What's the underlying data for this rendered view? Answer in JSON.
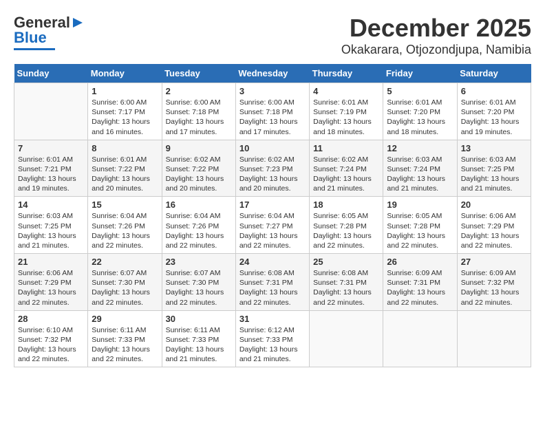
{
  "header": {
    "logo_line1": "General",
    "logo_line2": "Blue",
    "month": "December 2025",
    "location": "Okakarara, Otjozondjupa, Namibia"
  },
  "weekdays": [
    "Sunday",
    "Monday",
    "Tuesday",
    "Wednesday",
    "Thursday",
    "Friday",
    "Saturday"
  ],
  "weeks": [
    [
      {
        "day": "",
        "info": ""
      },
      {
        "day": "1",
        "info": "Sunrise: 6:00 AM\nSunset: 7:17 PM\nDaylight: 13 hours\nand 16 minutes."
      },
      {
        "day": "2",
        "info": "Sunrise: 6:00 AM\nSunset: 7:18 PM\nDaylight: 13 hours\nand 17 minutes."
      },
      {
        "day": "3",
        "info": "Sunrise: 6:00 AM\nSunset: 7:18 PM\nDaylight: 13 hours\nand 17 minutes."
      },
      {
        "day": "4",
        "info": "Sunrise: 6:01 AM\nSunset: 7:19 PM\nDaylight: 13 hours\nand 18 minutes."
      },
      {
        "day": "5",
        "info": "Sunrise: 6:01 AM\nSunset: 7:20 PM\nDaylight: 13 hours\nand 18 minutes."
      },
      {
        "day": "6",
        "info": "Sunrise: 6:01 AM\nSunset: 7:20 PM\nDaylight: 13 hours\nand 19 minutes."
      }
    ],
    [
      {
        "day": "7",
        "info": "Sunrise: 6:01 AM\nSunset: 7:21 PM\nDaylight: 13 hours\nand 19 minutes."
      },
      {
        "day": "8",
        "info": "Sunrise: 6:01 AM\nSunset: 7:22 PM\nDaylight: 13 hours\nand 20 minutes."
      },
      {
        "day": "9",
        "info": "Sunrise: 6:02 AM\nSunset: 7:22 PM\nDaylight: 13 hours\nand 20 minutes."
      },
      {
        "day": "10",
        "info": "Sunrise: 6:02 AM\nSunset: 7:23 PM\nDaylight: 13 hours\nand 20 minutes."
      },
      {
        "day": "11",
        "info": "Sunrise: 6:02 AM\nSunset: 7:24 PM\nDaylight: 13 hours\nand 21 minutes."
      },
      {
        "day": "12",
        "info": "Sunrise: 6:03 AM\nSunset: 7:24 PM\nDaylight: 13 hours\nand 21 minutes."
      },
      {
        "day": "13",
        "info": "Sunrise: 6:03 AM\nSunset: 7:25 PM\nDaylight: 13 hours\nand 21 minutes."
      }
    ],
    [
      {
        "day": "14",
        "info": "Sunrise: 6:03 AM\nSunset: 7:25 PM\nDaylight: 13 hours\nand 21 minutes."
      },
      {
        "day": "15",
        "info": "Sunrise: 6:04 AM\nSunset: 7:26 PM\nDaylight: 13 hours\nand 22 minutes."
      },
      {
        "day": "16",
        "info": "Sunrise: 6:04 AM\nSunset: 7:26 PM\nDaylight: 13 hours\nand 22 minutes."
      },
      {
        "day": "17",
        "info": "Sunrise: 6:04 AM\nSunset: 7:27 PM\nDaylight: 13 hours\nand 22 minutes."
      },
      {
        "day": "18",
        "info": "Sunrise: 6:05 AM\nSunset: 7:28 PM\nDaylight: 13 hours\nand 22 minutes."
      },
      {
        "day": "19",
        "info": "Sunrise: 6:05 AM\nSunset: 7:28 PM\nDaylight: 13 hours\nand 22 minutes."
      },
      {
        "day": "20",
        "info": "Sunrise: 6:06 AM\nSunset: 7:29 PM\nDaylight: 13 hours\nand 22 minutes."
      }
    ],
    [
      {
        "day": "21",
        "info": "Sunrise: 6:06 AM\nSunset: 7:29 PM\nDaylight: 13 hours\nand 22 minutes."
      },
      {
        "day": "22",
        "info": "Sunrise: 6:07 AM\nSunset: 7:30 PM\nDaylight: 13 hours\nand 22 minutes."
      },
      {
        "day": "23",
        "info": "Sunrise: 6:07 AM\nSunset: 7:30 PM\nDaylight: 13 hours\nand 22 minutes."
      },
      {
        "day": "24",
        "info": "Sunrise: 6:08 AM\nSunset: 7:31 PM\nDaylight: 13 hours\nand 22 minutes."
      },
      {
        "day": "25",
        "info": "Sunrise: 6:08 AM\nSunset: 7:31 PM\nDaylight: 13 hours\nand 22 minutes."
      },
      {
        "day": "26",
        "info": "Sunrise: 6:09 AM\nSunset: 7:31 PM\nDaylight: 13 hours\nand 22 minutes."
      },
      {
        "day": "27",
        "info": "Sunrise: 6:09 AM\nSunset: 7:32 PM\nDaylight: 13 hours\nand 22 minutes."
      }
    ],
    [
      {
        "day": "28",
        "info": "Sunrise: 6:10 AM\nSunset: 7:32 PM\nDaylight: 13 hours\nand 22 minutes."
      },
      {
        "day": "29",
        "info": "Sunrise: 6:11 AM\nSunset: 7:33 PM\nDaylight: 13 hours\nand 22 minutes."
      },
      {
        "day": "30",
        "info": "Sunrise: 6:11 AM\nSunset: 7:33 PM\nDaylight: 13 hours\nand 21 minutes."
      },
      {
        "day": "31",
        "info": "Sunrise: 6:12 AM\nSunset: 7:33 PM\nDaylight: 13 hours\nand 21 minutes."
      },
      {
        "day": "",
        "info": ""
      },
      {
        "day": "",
        "info": ""
      },
      {
        "day": "",
        "info": ""
      }
    ]
  ]
}
